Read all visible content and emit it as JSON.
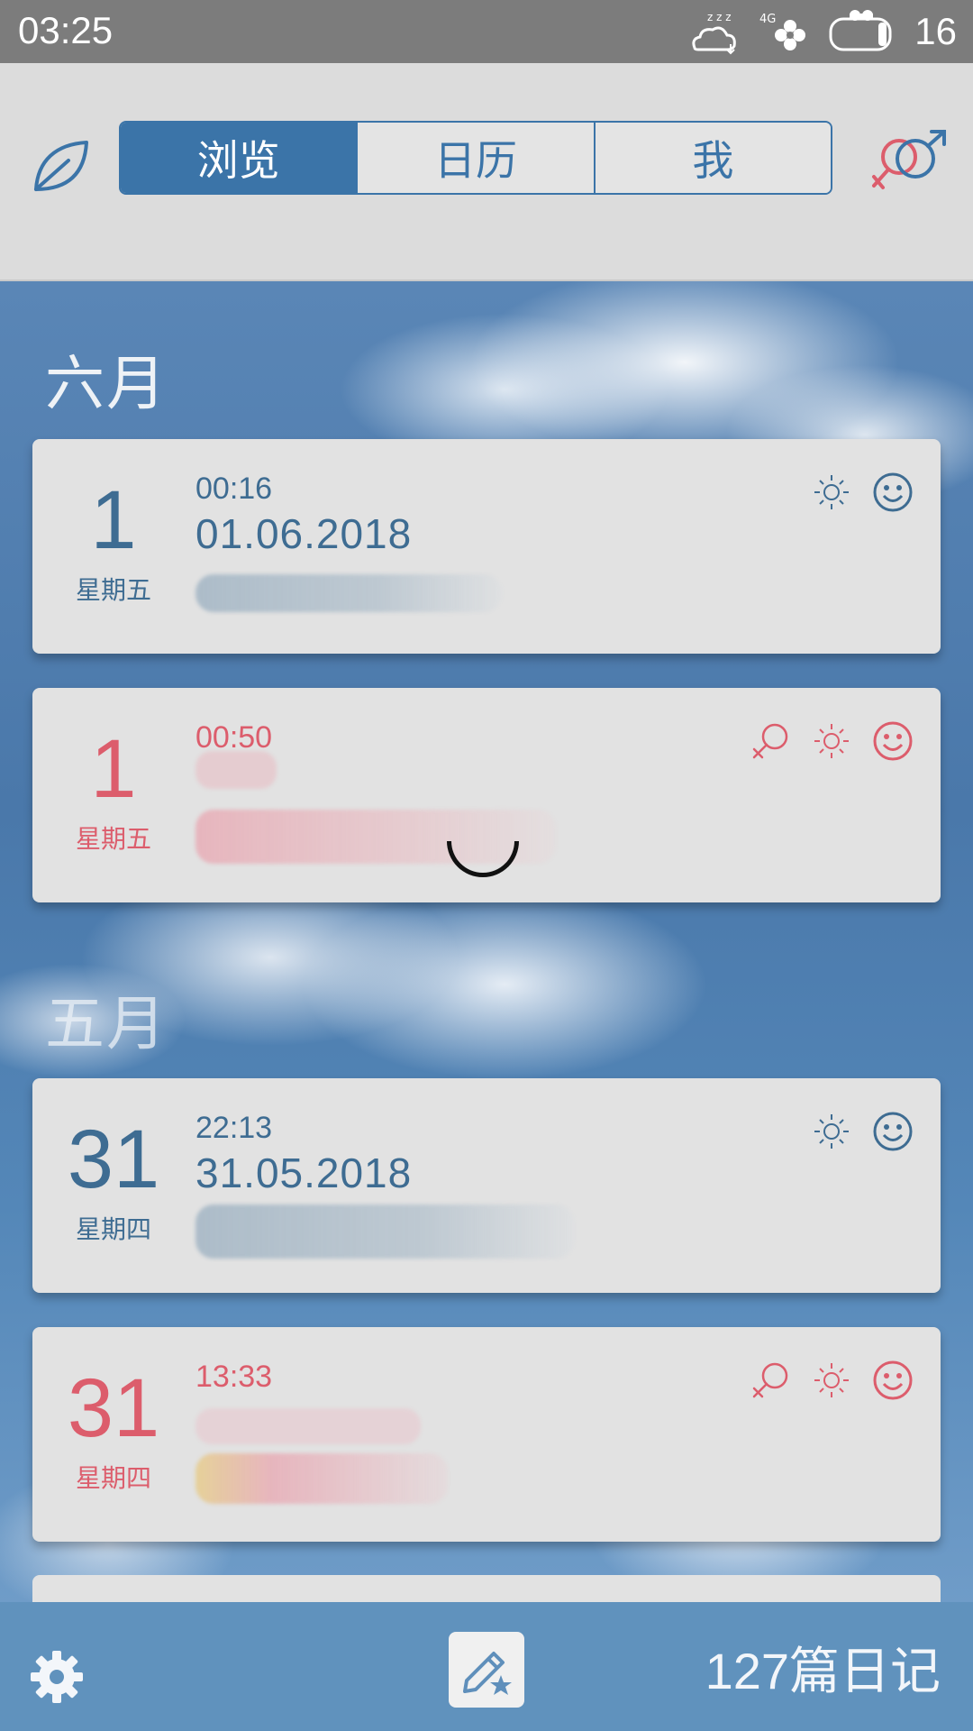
{
  "status_bar": {
    "time": "03:25",
    "network": "4G",
    "battery_level": "16",
    "icons": [
      "sleep-weather-icon",
      "network-signal-icon",
      "battery-icon"
    ]
  },
  "header": {
    "tabs": [
      {
        "label": "浏览",
        "active": true
      },
      {
        "label": "日历",
        "active": false
      },
      {
        "label": "我",
        "active": false
      }
    ],
    "left_icon": "leaf-icon",
    "right_icon": "gender-icon"
  },
  "sections": [
    {
      "month": "六月",
      "entries": [
        {
          "day": "1",
          "weekday": "星期五",
          "time": "00:16",
          "date": "01.06.2018",
          "theme": "blue",
          "icons": [
            "sun-icon",
            "smile-icon"
          ]
        },
        {
          "day": "1",
          "weekday": "星期五",
          "time": "00:50",
          "date": "",
          "theme": "pink",
          "icons": [
            "female-icon",
            "sun-icon",
            "smile-icon"
          ]
        }
      ]
    },
    {
      "month": "五月",
      "entries": [
        {
          "day": "31",
          "weekday": "星期四",
          "time": "22:13",
          "date": "31.05.2018",
          "theme": "blue",
          "icons": [
            "sun-icon",
            "smile-icon"
          ]
        },
        {
          "day": "31",
          "weekday": "星期四",
          "time": "13:33",
          "date": "",
          "theme": "pink",
          "icons": [
            "female-icon",
            "sun-icon",
            "smile-icon"
          ]
        }
      ]
    }
  ],
  "bottom_bar": {
    "entry_count": "127篇日记",
    "left_icon": "gear-icon",
    "center_icon": "write-diary-icon"
  },
  "colors": {
    "accent_blue": "#3b74a8",
    "entry_blue": "#3e6c92",
    "entry_pink": "#dc5d6c",
    "bottom_bar": "#6092bd"
  }
}
